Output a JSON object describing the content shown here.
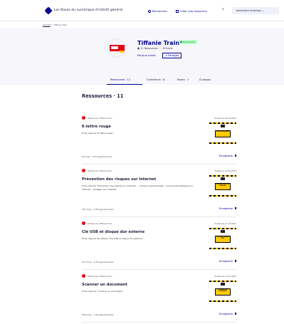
{
  "header": {
    "site_title": "Les Bases du numérique d'intérêt général",
    "search_label": "Rechercher",
    "create_label": "Créer une ressource",
    "help_icon": "help-icon",
    "user_name": "alexandre martinez"
  },
  "breadcrumb": {
    "home": "Accueil",
    "separator": ">",
    "current": "Tiffanie Train"
  },
  "profile": {
    "name": "Tiffanie Train",
    "public_badge": "Profil public",
    "resources_stat": "11 Ressources",
    "followers_stat": "8 Suivis",
    "follow_label": "Ne plus suivre",
    "share_label": "Partager"
  },
  "tabs": [
    {
      "label": "Ressources · 11"
    },
    {
      "label": "Collections · 8"
    },
    {
      "label": "Bases · 1"
    },
    {
      "label": "À propos"
    }
  ],
  "section_title": "Ressources · 11",
  "cards": [
    {
      "author": "Publiée par Tiffanie Train",
      "date": "Publiée le 18.10.2023",
      "title": "E-lettre rouge",
      "description": "Fiche résumé \"E-lettre rouge\".",
      "thumb_text": "E-LETTRE ROUGE",
      "views": "90 Vues",
      "saves": "0 Enregistrements",
      "save_label": "Enregistrer"
    },
    {
      "author": "Publiée par Tiffanie Train",
      "date": "Publiée le 18.10.2023",
      "title": "Prévention des risques sur Internet",
      "description": "Fiche résumé \"Prévention des risques sur Internet\" : - Arnaque sentimentale, - Les bonnes pratiques sur Internet, - Protéger son matériel",
      "thumb_text": "PRÉVENTION DES RISQUES",
      "views": "387 Vues",
      "saves": "0 Enregistrements",
      "save_label": "Enregistrer"
    },
    {
      "author": "Publiée par Tiffanie Train",
      "date": "Publiée le 17.10.2023",
      "title": "Clé USB et disque dur externe",
      "description": "Fiche résumé de l'atelier \"Clé USB et disque dur externe\".",
      "thumb_text": "CLÉ USB, DISQUE DUR",
      "views": "412 Vues",
      "saves": "6 Enregistrements",
      "save_label": "Enregistrer"
    },
    {
      "author": "Publiée par Tiffanie Train",
      "date": "Publiée le 13.10.2023",
      "title": "Scanner un document",
      "description": "Fiche résumé \" Scanner un document\".",
      "thumb_text": "SCANNER UN DOCUMENT",
      "views": "289 Vues",
      "saves": "5 Enregistrements",
      "save_label": "Enregistrer"
    }
  ],
  "colors": {
    "primary": "#000091",
    "accent_red": "#e1000f",
    "badge_green": "#18753c",
    "yellow": "#ffca00"
  }
}
